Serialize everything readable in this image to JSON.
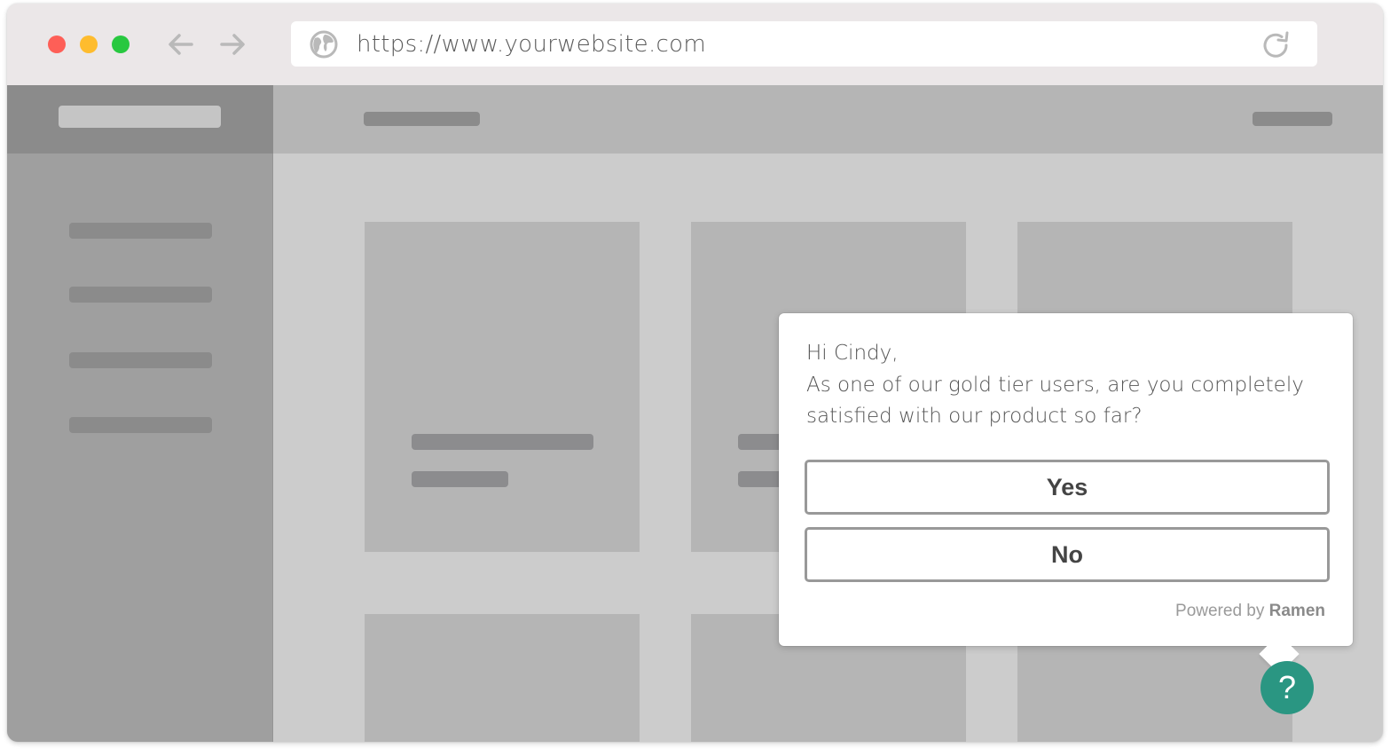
{
  "browser": {
    "window_controls": [
      "close",
      "minimize",
      "maximize"
    ],
    "nav": {
      "back_icon": "arrow-left-icon",
      "forward_icon": "arrow-right-icon"
    },
    "address_bar": {
      "url": "https://www.yourwebsite.com",
      "site_icon": "globe-icon",
      "reload_icon": "reload-icon"
    }
  },
  "wireframe": {
    "sidebar_items_count": 4,
    "cards_count": 6,
    "colors": {
      "sidebar_header": "#8b8b8b",
      "sidebar": "#9f9f9f",
      "topbar": "#b5b5b5",
      "canvas": "#cccccc",
      "card": "#b5b5b5",
      "placeholder": "#8b8b8b"
    }
  },
  "survey": {
    "greeting": "Hi Cindy,",
    "question": "As one of our gold tier users, are you completely satisfied with our product so far?",
    "options": [
      {
        "label": "Yes"
      },
      {
        "label": "No"
      }
    ],
    "powered_by_prefix": "Powered by",
    "powered_by_brand": "Ramen",
    "help_button_label": "?",
    "accent_color": "#2a9682"
  }
}
